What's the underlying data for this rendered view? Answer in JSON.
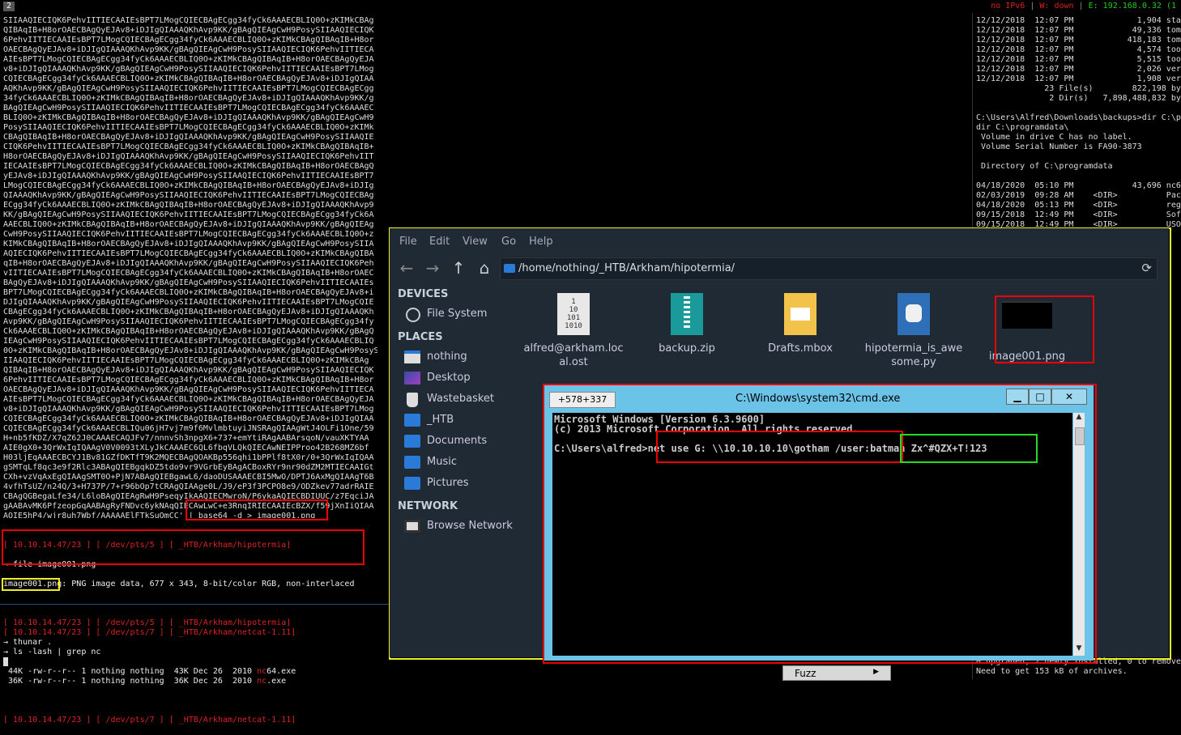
{
  "topbar": {
    "workspace": "2",
    "status_ipv6": "no IPv6",
    "status_w": "W: down",
    "status_e": "E: 192.168.0.32 (1"
  },
  "left_terminal": {
    "base64_lines": [
      "SIIAAQIECIQK6PehvIITIECAAIEsBPT7LMogCQIECBAgECgg34fyCk6AAAECBLIQ0O+zKIMkCBAg",
      "QIBAqIB+H8orOAECBAgQyEJAv8+iDJIgQIAAAQKhAvp9KK/gBAgQIEAgCwH9PosySIIAAQIECIQK",
      "6PehvIITIECAAIEsBPT7LMogCQIECBAgECgg34fyCk6AAAECBLIQ0O+zKIMkCBAgQIBAqIB+H8or",
      "OAECBAgQyEJAv8+iDJIgQIAAAQKhAvp9KK/gBAgQIEAgCwH9PosySIIAAQIECIQK6PehvIITIECA",
      "AIEsBPT7LMogCQIECBAgECgg34fyCk6AAAECBLIQ0O+zKIMkCBAgQIBAqIB+H8orOAECBAgQyEJA",
      "v8+iDJIgQIAAAQKhAvp9KK/gBAgQIEAgCwH9PosySIIAAQIECIQK6PehvIITIECAAIEsBPT7LMog",
      "CQIECBAgECgg34fyCk6AAAECBLIQ0O+zKIMkCBAgQIBAqIB+H8orOAECBAgQyEJAv8+iDJIgQIAA",
      "AQKhAvp9KK/gBAgQIEAgCwH9PosySIIAAQIECIQK6PehvIITIECAAIEsBPT7LMogCQIECBAgECgg",
      "34fyCk6AAAECBLIQ0O+zKIMkCBAgQIBAqIB+H8orOAECBAgQyEJAv8+iDJIgQIAAAQKhAvp9KK/g",
      "BAgQIEAgCwH9PosySIIAAQIECIQK6PehvIITIECAAIEsBPT7LMogCQIECBAgECgg34fyCk6AAAEC",
      "BLIQ0O+zKIMkCBAgQIBAqIB+H8orOAECBAgQyEJAv8+iDJIgQIAAAQKhAvp9KK/gBAgQIEAgCwH9",
      "PosySIIAAQIECIQK6PehvIITIECAAIEsBPT7LMogCQIECBAgECgg34fyCk6AAAECBLIQ0O+zKIMk",
      "CBAgQIBAqIB+H8orOAECBAgQyEJAv8+iDJIgQIAAAQKhAvp9KK/gBAgQIEAgCwH9PosySIIAAQIE",
      "CIQK6PehvIITIECAAIEsBPT7LMogCQIECBAgECgg34fyCk6AAAECBLIQ0O+zKIMkCBAgQIBAqIB+",
      "H8orOAECBAgQyEJAv8+iDJIgQIAAAQKhAvp9KK/gBAgQIEAgCwH9PosySIIAAQIECIQK6PehvIIT",
      "IECAAIEsBPT7LMogCQIECBAgECgg34fyCk6AAAECBLIQ0O+zKIMkCBAgQIBAqIB+H8orOAECBAgQ",
      "yEJAv8+iDJIgQIAAAQKhAvp9KK/gBAgQIEAgCwH9PosySIIAAQIECIQK6PehvIITIECAAIEsBPT7",
      "LMogCQIECBAgECgg34fyCk6AAAECBLIQ0O+zKIMkCBAgQIBAqIB+H8orOAECBAgQyEJAv8+iDJIg",
      "QIAAAQKhAvp9KK/gBAgQIEAgCwH9PosySIIAAQIECIQK6PehvIITIECAAIEsBPT7LMogCQIECBAg",
      "ECgg34fyCk6AAAECBLIQ0O+zKIMkCBAgQIBAqIB+H8orOAECBAgQyEJAv8+iDJIgQIAAAQKhAvp9",
      "KK/gBAgQIEAgCwH9PosySIIAAQIECIQK6PehvIITIECAAIEsBPT7LMogCQIECBAgECgg34fyCk6A",
      "AAECBLIQ0O+zKIMkCBAgQIBAqIB+H8orOAECBAgQyEJAv8+iDJIgQIAAAQKhAvp9KK/gBAgQIEAg",
      "CwH9PosySIIAAQIECIQK6PehvIITIECAAIEsBPT7LMogCQIECBAgECgg34fyCk6AAAECBLIQ0O+z",
      "KIMkCBAgQIBAqIB+H8orOAECBAgQyEJAv8+iDJIgQIAAAQKhAvp9KK/gBAgQIEAgCwH9PosySIIA",
      "AQIECIQK6PehvIITIECAAIEsBPT7LMogCQIECBAgECgg34fyCk6AAAECBLIQ0O+zKIMkCBAgQIBA",
      "qIB+H8orOAECBAgQyEJAv8+iDJIgQIAAAQKhAvp9KK/gBAgQIEAgCwH9PosySIIAAQIECIQK6Peh",
      "vIITIECAAIEsBPT7LMogCQIECBAgECgg34fyCk6AAAECBLIQ0O+zKIMkCBAgQIBAqIB+H8orOAEC",
      "BAgQyEJAv8+iDJIgQIAAAQKhAvp9KK/gBAgQIEAgCwH9PosySIIAAQIECIQK6PehvIITIECAAIEs",
      "BPT7LMogCQIECBAgECgg34fyCk6AAAECBLIQ0O+zKIMkCBAgQIBAqIB+H8orOAECBAgQyEJAv8+i",
      "DJIgQIAAAQKhAvp9KK/gBAgQIEAgCwH9PosySIIAAQIECIQK6PehvIITIECAAIEsBPT7LMogCQIE",
      "CBAgECgg34fyCk6AAAECBLIQ0O+zKIMkCBAgQIBAqIB+H8orOAECBAgQyEJAv8+iDJIgQIAAAQKh",
      "Avp9KK/gBAgQIEAgCwH9PosySIIAAQIECIQK6PehvIITIECAAIEsBPT7LMogCQIECBAgECgg34fy",
      "Ck6AAAECBLIQ0O+zKIMkCBAgQIBAqIB+H8orOAECBAgQyEJAv8+iDJIgQIAAAQKhAvp9KK/gBAgQ",
      "IEAgCwH9PosySIIAAQIECIQK6PehvIITIECAAIEsBPT7LMogCQIECBAgECgg34fyCk6AAAECBLIQ",
      "0O+zKIMkCBAgQIBAqIB+H8orOAECBAgQyEJAv8+iDJIgQIAAAQKhAvp9KK/gBAgQIEAgCwH9PosyS",
      "IIAAQIECIQK6PehvIITIECAAIEsBPT7LMogCQIECBAgECgg34fyCk6AAAECBLIQ0O+zKIMkCBAg",
      "QIBAqIB+H8orOAECBAgQyEJAv8+iDJIgQIAAAQKhAvp9KK/gBAgQIEAgCwH9PosySIIAAQIECIQK",
      "6PehvIITIECAAIEsBPT7LMogCQIECBAgECgg34fyCk6AAAECBLIQ0O+zKIMkCBAgQIBAqIB+H8or",
      "OAECBAgQyEJAv8+iDJIgQIAAAQKhAvp9KK/gBAgQIEAgCwH9PosySIIAAQIECIQK6PehvIITIECA",
      "AIEsBPT7LMogCQIECBAgECgg34fyCk6AAAECBLIQ0O+zKIMkCBAgQIBAqIB+H8orOAECBAgQyEJA",
      "v8+iDJIgQIAAAQKhAvp9KK/gBAgQIEAgCwH9PosySIIAAQIECIQK6PehvIITIECAAIEsBPT7LMog",
      "CQIECBAgECgg34fyCk6AAAECBLIQ0O+zKIMkCBAgQIBAqIB+H8orOAECBAgQyEJAv8+iDJIgQIAA",
      "CQIECBAgECgg34fyCk6AAAECBLIQu06jH7vj7m9f6MvlmbtuyiJNSRAgQIAAgWtJ4OLFi1One/59",
      "H+nb5fKDZ/X7qZ62J0CAAAECAQJFv7/nnnvSh3npgX6+737+emYtiRAgAABArsqoN/vauXKTYAA",
      "AIE0gX0+3QrWxIqIQAAgV0V0093tXLyJkCAAAEC6QL6fbqVLQkQIECAwNEIPProo42B268MZ6bf",
      "H03ljEqAAAECBCYJ1Bv81GZfDKTfT9K2MQECBAgQOAKBp556qhi1bPPlf8tX0r/0+3QrWxIqIQAA",
      "gSMTqLf8qc3e9f2Rlc3ABAgQIEBgqkDZ5tdo9vr9VGrbEyBAgACBoxRYr9nr90dZM2MTIECAAIGt",
      "CXh+vzVqAxEgQIAAgSMT0O+PjN7ABAgQIEBgawL6/daoDUSAAAECBI5MwO/DPTJ6AxMgQIAAgT6B",
      "4vfhTsUZ/n24Q/3+H737P/7+r96bOp7tCRAgQIAAge0L/J9/eP3f3PCPO8e9/ODZkev77adrRAIE",
      "CBAgQGBegaLfe34/L6loBAgQIEAgRwH9PseqyIkAAQIECMwroN/P6ykaAQIECBDIUUC/z7EqciJA",
      "gAABAvMK6PfzeopGqAABAgRyFNDvc6ykNAqQIECAwLwC+e3RnqIRIECAAIEcBZX/f59jXnIiQIAA",
      "AQIE5hP4/wjr8uh7Wbf/AAAAAElFTkSuQmCC' | base64 -d > image001.png"
    ],
    "prompt1": {
      "host": "[ 10.10.14.47/23 ]",
      "pts": "[ /dev/pts/5 ]",
      "path": "[ _HTB/Arkham/hipotermia]"
    },
    "cmd_file": "→ file image001.png",
    "file_output": "image001.png: PNG image data, 677 x 343, 8-bit/color RGB, non-interlaced",
    "prompt2": {
      "host": "[ 10.10.14.47/23 ]",
      "pts": "[ /dev/pts/5 ]",
      "path": "[ _HTB/Arkham/hipotermia]"
    },
    "cmd_thunar": "→ thunar .",
    "prompt3": {
      "host": "[ 10.10.14.47/23 ]",
      "pts": "[ /dev/pts/7 ]",
      "path": "[ _HTB/Arkham/netcat-1.11]"
    },
    "cmd_ls": "→ ls -lash | grep nc",
    "ls_lines": [
      {
        "pre": " 44K -rw-r--r-- 1 nothing nothing  43K Dec 26  2010 ",
        "hl": "nc",
        "post": "64.exe"
      },
      {
        "pre": " 36K -rw-r--r-- 1 nothing nothing  36K Dec 26  2010 ",
        "hl": "nc",
        "post": ".exe"
      }
    ],
    "prompt4": {
      "host": "[ 10.10.14.47/23 ]",
      "pts": "[ /dev/pts/7 ]",
      "path": "[ _HTB/Arkham/netcat-1.11]"
    }
  },
  "right_terminal": {
    "lines": [
      "12/12/2018  12:07 PM             1,904 sta",
      "12/12/2018  12:07 PM            49,336 tom",
      "12/12/2018  12:07 PM           418,183 tom",
      "12/12/2018  12:07 PM             4,574 too",
      "12/12/2018  12:07 PM             5,515 too",
      "12/12/2018  12:07 PM             2,026 ver",
      "12/12/2018  12:07 PM             1,908 ver",
      "              23 File(s)        822,198 by",
      "               2 Dir(s)   7,898,488,832 by",
      "",
      "C:\\Users\\Alfred\\Downloads\\backups>dir C:\\p",
      "dir C:\\programdata\\",
      " Volume in drive C has no label.",
      " Volume Serial Number is FA90-3873",
      "",
      " Directory of C:\\programdata",
      "",
      "04/18/2020  05:10 PM            43,696 nc6",
      "02/03/2019  09:28 AM    <DIR>          Pac",
      "04/18/2020  05:13 PM    <DIR>          reg",
      "09/15/2018  12:49 PM    <DIR>          Sof",
      "09/15/2018  12:49 PM    <DIR>          USO"
    ],
    "tail": [
      "0 upgraded, 2 newly installed, 0 to remove",
      "Need to get 153 kB of archives."
    ]
  },
  "file_manager": {
    "menu": [
      "File",
      "Edit",
      "View",
      "Go",
      "Help"
    ],
    "path": "/home/nothing/_HTB/Arkham/hipotermia/",
    "sidebar": {
      "devices_label": "DEVICES",
      "devices": [
        {
          "label": "File System",
          "icon": "drive-icon"
        }
      ],
      "places_label": "PLACES",
      "places": [
        {
          "label": "nothing",
          "icon": "home-folder-icon"
        },
        {
          "label": "Desktop",
          "icon": "desktop-icon"
        },
        {
          "label": "Wastebasket",
          "icon": "trash-icon"
        },
        {
          "label": "_HTB",
          "icon": "folder-icon"
        },
        {
          "label": "Documents",
          "icon": "folder-icon"
        },
        {
          "label": "Music",
          "icon": "folder-icon"
        },
        {
          "label": "Pictures",
          "icon": "folder-icon"
        }
      ],
      "network_label": "NETWORK",
      "network": [
        {
          "label": "Browse Network",
          "icon": "network-icon"
        }
      ]
    },
    "files": [
      {
        "name": "alfred@arkham.loc\nal.ost",
        "icon": "binary-file-icon"
      },
      {
        "name": "backup.zip",
        "icon": "zip-icon"
      },
      {
        "name": "Drafts.mbox",
        "icon": "mail-icon"
      },
      {
        "name": "hipotermia_is_awe\nsome.py",
        "icon": "python-icon"
      },
      {
        "name": "image001.png",
        "icon": "image-icon"
      }
    ]
  },
  "cmd_window": {
    "coords": "+578+337",
    "title": "C:\\Windows\\system32\\cmd.exe",
    "line1": "Microsoft Windows [Version 6.3.9600]",
    "line2": "(c) 2013 Microsoft Corporation. All rights reserved.",
    "prompt": "C:\\Users\\alfred>",
    "command": "net use G: \\\\10.10.10.10\\gotham /user:",
    "credentials": "batman Zx^#QZX+T!123"
  },
  "fuzz_button": "Fuzz",
  "colors": {
    "terminal_bg": "#000000",
    "prompt_red": "#dd2222",
    "prompt_green": "#22cc22",
    "fm_bg": "#1f2a35",
    "cmd_frame": "#6bc4e8",
    "highlight_red": "#ee0000",
    "highlight_yellow": "#eeee22",
    "highlight_green": "#22dd22"
  }
}
